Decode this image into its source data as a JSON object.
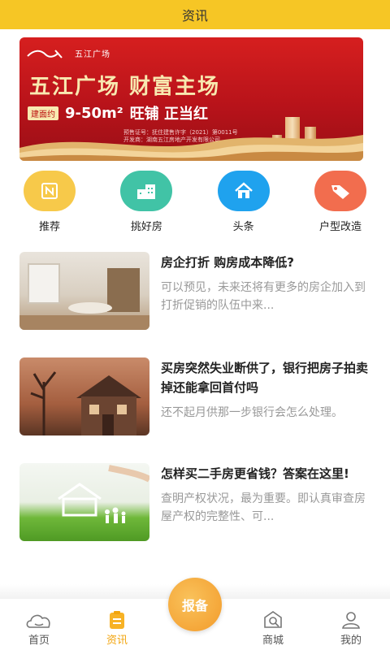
{
  "header": {
    "title": "资讯"
  },
  "banner": {
    "brand": "五江广场",
    "headline": "五江广场  财富主场",
    "area_label": "建面约",
    "area": "9-50m²",
    "slogan": "旺铺  正当红",
    "license_line1": "预售证号：抚住建售许字（2021）第0011号",
    "license_line2": "开发商：湖南五江房地产开发有限公司"
  },
  "categories": [
    {
      "label": "推荐",
      "icon": "recommend-icon",
      "color": "#f7c94a"
    },
    {
      "label": "挑好房",
      "icon": "house-building-icon",
      "color": "#41c3a6"
    },
    {
      "label": "头条",
      "icon": "home-icon",
      "color": "#1fa2ee"
    },
    {
      "label": "户型改造",
      "icon": "tag-icon",
      "color": "#f26d4e"
    }
  ],
  "news": [
    {
      "title": "房企打折 购房成本降低?",
      "summary": "可以预见，未来还将有更多的房企加入到打折促销的队伍中来..."
    },
    {
      "title": "买房突然失业断供了，银行把房子拍卖掉还能拿回首付吗",
      "summary": "还不起月供那一步银行会怎么处理。"
    },
    {
      "title": "怎样买二手房更省钱？答案在这里!",
      "summary": "查明产权状况，最为重要。即认真审查房屋产权的完整性、可..."
    }
  ],
  "bottom_nav": {
    "home": "首页",
    "news": "资讯",
    "center": "报备",
    "mall": "商城",
    "mine": "我的"
  },
  "colors": {
    "header": "#f6c625",
    "accent": "#f2a40c"
  }
}
